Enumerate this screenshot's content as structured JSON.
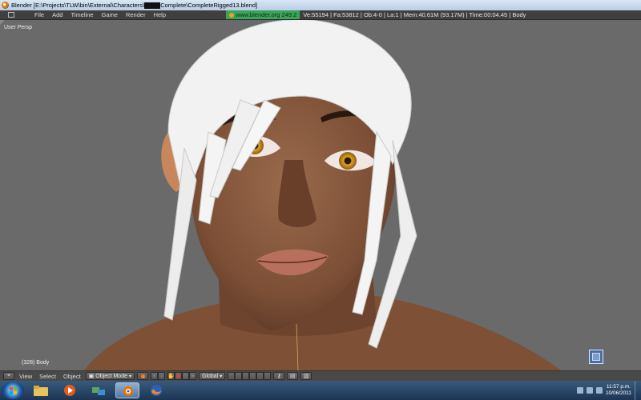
{
  "window": {
    "title_prefix": "Blender [E:\\Projects\\TLW\\bin\\External\\Characters\\",
    "title_suffix": "Complete\\CompleteRigged13.blend]"
  },
  "info_header": {
    "menus": [
      "File",
      "Add",
      "Timeline",
      "Game",
      "Render",
      "Help"
    ],
    "site": "www.blender.org 249.2",
    "stats": "Ve:55194 | Fa:53812 | Ob:4-0 | La:1 | Mem:40.61M (93.17M) | Time:00:04.45 | Body"
  },
  "viewport": {
    "view_label": "User Persp",
    "object_label": "(328) Body"
  },
  "footer": {
    "menus": [
      "View",
      "Select",
      "Object"
    ],
    "mode": "Object Mode",
    "orientation": "Global"
  },
  "taskbar": {
    "time": "11:57 p.m.",
    "date": "10/06/2011"
  },
  "colors": {
    "viewport_bg": "#6a6a6a",
    "skin": "#8a5a40",
    "hair": "#f2f2f2",
    "iris": "#c8901e",
    "site_badge": "#39a55a"
  }
}
